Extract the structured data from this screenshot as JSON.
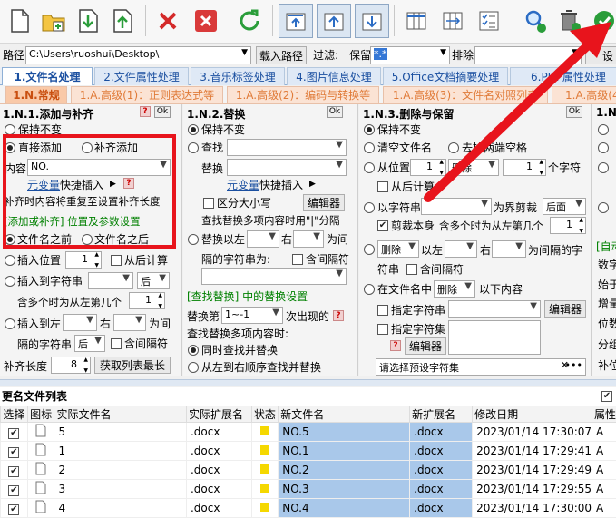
{
  "toolbar": {
    "items": [
      {
        "name": "new-file-icon"
      },
      {
        "name": "open-folder-icon"
      },
      {
        "name": "import-icon"
      },
      {
        "name": "export-icon"
      },
      {
        "name": "delete-icon"
      },
      {
        "name": "clear-icon"
      },
      {
        "name": "refresh-icon"
      },
      {
        "name": "move-top-icon"
      },
      {
        "name": "move-up-icon"
      },
      {
        "name": "move-down-icon"
      },
      {
        "name": "columns-left-icon"
      },
      {
        "name": "columns-right-icon"
      },
      {
        "name": "checklist-icon"
      },
      {
        "name": "search-preview-icon"
      },
      {
        "name": "trash-preview-icon"
      },
      {
        "name": "execute-icon"
      }
    ]
  },
  "pathbar": {
    "path_label": "路径",
    "path_value": "C:\\Users\\ruoshui\\Desktop\\",
    "load_button": "载入路径",
    "filter_label": "过滤:",
    "keep_label": "保留",
    "keep_value": "*.*",
    "exclude_label": "排除",
    "settings_partial": "设"
  },
  "main_tabs": [
    "1.文件名处理",
    "2.文件属性处理",
    "3.音乐标签处理",
    "4.图片信息处理",
    "5.Office文档摘要处理",
    "6.PDF属性处理"
  ],
  "sub_tabs": [
    "1.N.常规",
    "1.A.高级(1)：正则表达式等",
    "1.A.高级(2)：编码与转换等",
    "1.A.高级(3)：文件名对照列表",
    "1.A.高级(4)"
  ],
  "panel1": {
    "title": "1.N.1.添加与补齐",
    "ok": "Ok",
    "keep": "保持不变",
    "direct_add": "直接添加",
    "pad_add": "补齐添加",
    "content_label": "内容",
    "content_value": "NO.",
    "var_link": "元变量",
    "quick_insert": "快捷插入",
    "pad_note": "补齐时内容将重复至设置补齐长度",
    "pos_header": "[添加或补齐] 位置及参数设置",
    "before_name": "文件名之前",
    "after_name": "文件名之后",
    "insert_pos": "插入位置",
    "insert_pos_value": "1",
    "from_back": "从后计算",
    "insert_to_string": "插入到字符串",
    "after_word": "后",
    "multi_note": "含多个时为从左第几个",
    "multi_value": "1",
    "insert_left": "插入到左",
    "right_word": "右",
    "between": "为间",
    "gap_string": "隔的字符串",
    "gap_after": "后",
    "contain_gap": "含间隔符",
    "pad_len": "补齐长度",
    "pad_len_value": "8",
    "get_max": "获取列表最长"
  },
  "panel2": {
    "title": "1.N.2.替换",
    "ok": "Ok",
    "keep": "保持不变",
    "find": "查找",
    "replace": "替换",
    "var_link": "元变量",
    "quick_insert": "快捷插入",
    "case": "区分大小写",
    "editor": "编辑器",
    "multi_note": "查找替换多项内容时用\"|\"分隔",
    "replace_left": "替换以左",
    "right": "右",
    "between": "为间",
    "gap_string": "隔的字符串为:",
    "contain_gap": "含间隔符",
    "find_header": "[查找替换] 中的替换设置",
    "replace_nth": "替换第",
    "nth_value": "1~-1",
    "occurrence": "次出现的",
    "multi_how": "查找替换多项内容时:",
    "simul": "同时查找并替换",
    "l2r": "从左到右顺序查找并替换"
  },
  "panel3": {
    "title": "1.N.3.删除与保留",
    "ok": "Ok",
    "keep": "保持不变",
    "clear_name": "清空文件名",
    "trim_space": "去掉两端空格",
    "from_pos": "从位置",
    "from_pos_value": "1",
    "delete_word": "删除",
    "count_value": "1",
    "chars": "个字符",
    "from_back": "从后计算",
    "by_string": "以字符串",
    "boundary": "为界剪裁",
    "after_word": "后面",
    "cut_self": "剪裁本身",
    "multi_note": "含多个时为从左第几个",
    "multi_value": "1",
    "del_left": "以左",
    "right": "右",
    "gap_chars": "为间隔的字",
    "char_string": "符串",
    "contain_gap": "含间隔符",
    "in_name": "在文件名中",
    "below": "以下内容",
    "spec_string": "指定字符串",
    "spec_set": "指定字符集",
    "editor": "编辑器",
    "preset_placeholder": "请选择预设字符集"
  },
  "panel4": {
    "title": "1.N",
    "auto_label": "[自动",
    "lines": [
      "数字",
      "始于",
      "增量",
      "位数",
      "分组",
      "补位"
    ]
  },
  "file_list": {
    "title": "更名文件列表",
    "columns": [
      "选择",
      "图标",
      "实际文件名",
      "实际扩展名",
      "状态",
      "新文件名",
      "新扩展名",
      "修改日期",
      "属性"
    ],
    "rows": [
      {
        "name": "5",
        "ext": ".docx",
        "new": "NO.5",
        "newext": ".docx",
        "date": "2023/01/14 17:30:07",
        "attr": "A"
      },
      {
        "name": "1",
        "ext": ".docx",
        "new": "NO.1",
        "newext": ".docx",
        "date": "2023/01/14 17:29:41",
        "attr": "A"
      },
      {
        "name": "2",
        "ext": ".docx",
        "new": "NO.2",
        "newext": ".docx",
        "date": "2023/01/14 17:29:49",
        "attr": "A"
      },
      {
        "name": "3",
        "ext": ".docx",
        "new": "NO.3",
        "newext": ".docx",
        "date": "2023/01/14 17:29:55",
        "attr": "A"
      },
      {
        "name": "4",
        "ext": ".docx",
        "new": "NO.4",
        "newext": ".docx",
        "date": "2023/01/14 17:30:00",
        "attr": "A"
      }
    ]
  },
  "colors": {
    "highlight_box": "#e8141c",
    "arrow": "#e8141c",
    "tab_active_text": "#d4671c",
    "selection": "#a9c8ea",
    "status_yellow": "#f5d800"
  }
}
